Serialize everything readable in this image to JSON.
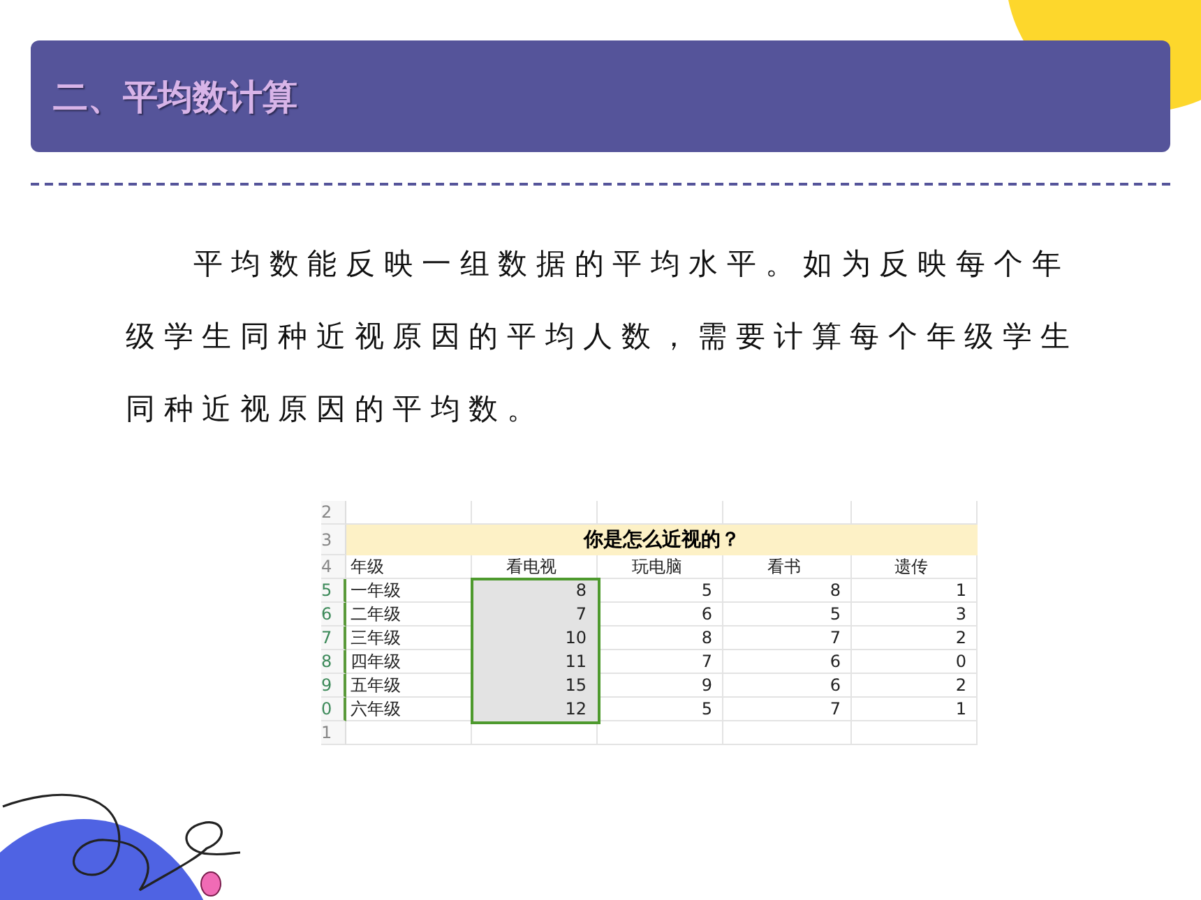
{
  "header": {
    "title": "二、平均数计算"
  },
  "paragraph": "平均数能反映一组数据的平均水平。如为反映每个年级学生同种近视原因的平均人数，需要计算每个年级学生同种近视原因的平均数。",
  "spreadsheet": {
    "blank_row": "2",
    "title_row": "3",
    "title": "你是怎么近视的？",
    "header_row": "4",
    "columns": [
      {
        "label": "年级",
        "selected": false
      },
      {
        "label": "看电视",
        "selected": true
      },
      {
        "label": "玩电脑",
        "selected": false
      },
      {
        "label": "看书",
        "selected": false
      },
      {
        "label": "遗传",
        "selected": false
      }
    ],
    "rows": [
      {
        "row_number": "5",
        "cells": [
          "一年级",
          "8",
          "5",
          "8",
          "1"
        ]
      },
      {
        "row_number": "6",
        "cells": [
          "二年级",
          "7",
          "6",
          "5",
          "3"
        ]
      },
      {
        "row_number": "7",
        "cells": [
          "三年级",
          "10",
          "8",
          "7",
          "2"
        ]
      },
      {
        "row_number": "8",
        "cells": [
          "四年级",
          "11",
          "7",
          "6",
          "0"
        ]
      },
      {
        "row_number": "9",
        "cells": [
          "五年级",
          "15",
          "9",
          "6",
          "2"
        ]
      },
      {
        "row_number": "0",
        "cells": [
          "六年级",
          "12",
          "5",
          "7",
          "1"
        ]
      }
    ],
    "last_row": "1"
  }
}
